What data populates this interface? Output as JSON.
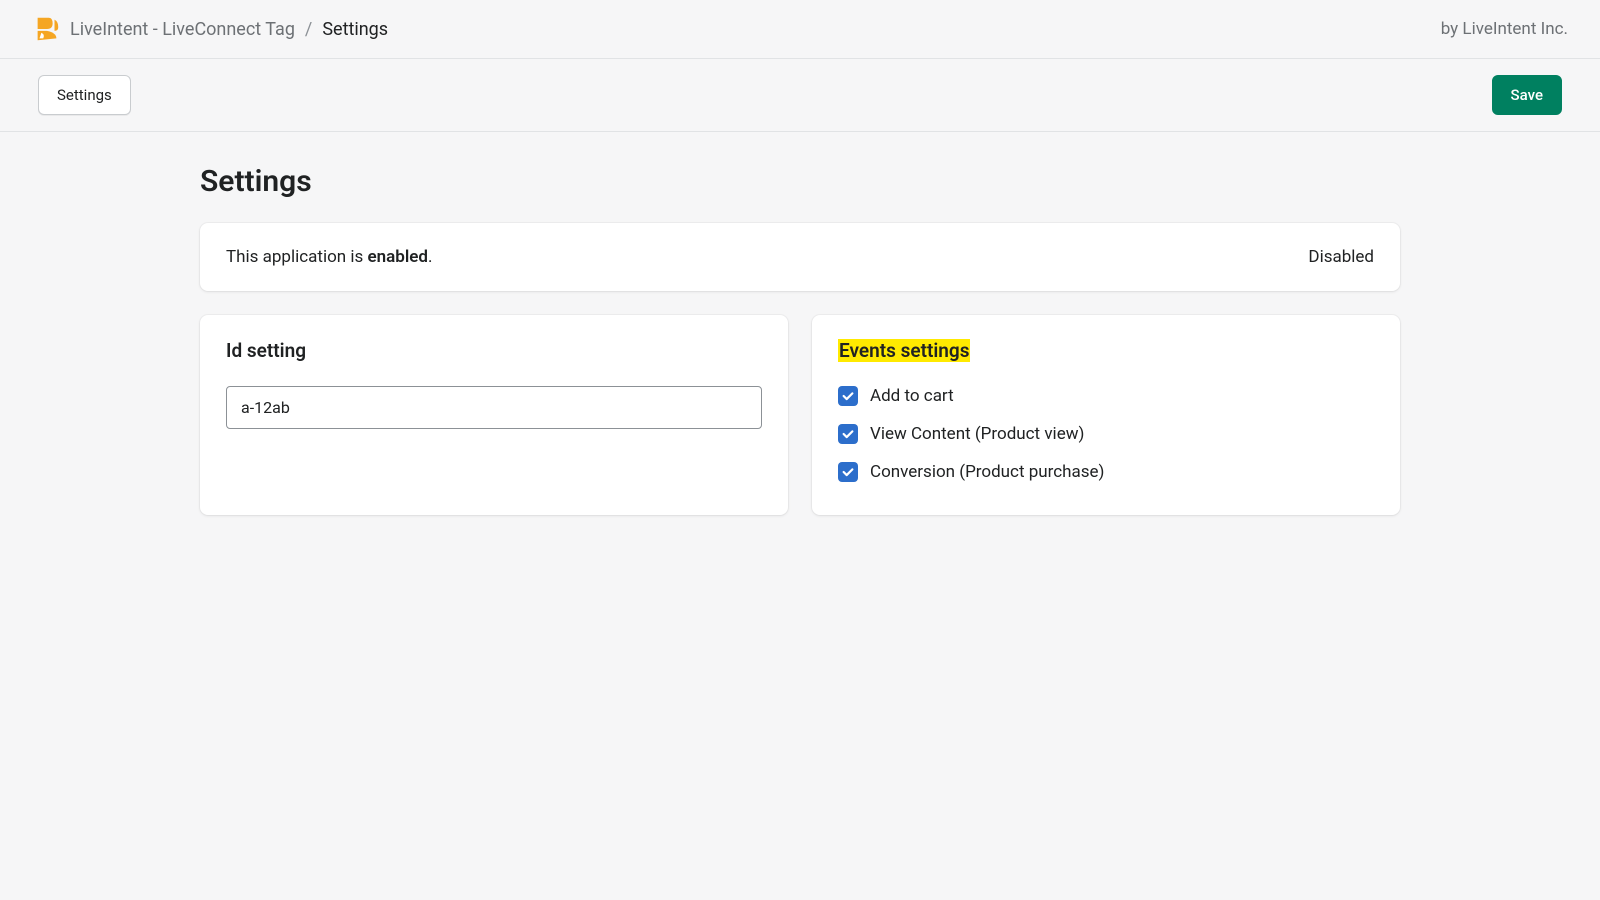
{
  "header": {
    "app_name": "LiveIntent - LiveConnect Tag",
    "separator": "/",
    "current_page": "Settings",
    "vendor": "by LiveIntent Inc."
  },
  "toolbar": {
    "settings_label": "Settings",
    "save_label": "Save"
  },
  "page": {
    "title": "Settings"
  },
  "status_card": {
    "prefix": "This application is ",
    "status_word": "enabled",
    "suffix": ".",
    "toggle_label": "Disabled"
  },
  "id_card": {
    "title": "Id setting",
    "value": "a-12ab"
  },
  "events_card": {
    "title": "Events settings",
    "items": [
      {
        "label": "Add to cart",
        "checked": true
      },
      {
        "label": "View Content (Product view)",
        "checked": true
      },
      {
        "label": "Conversion (Product purchase)",
        "checked": true
      }
    ]
  }
}
